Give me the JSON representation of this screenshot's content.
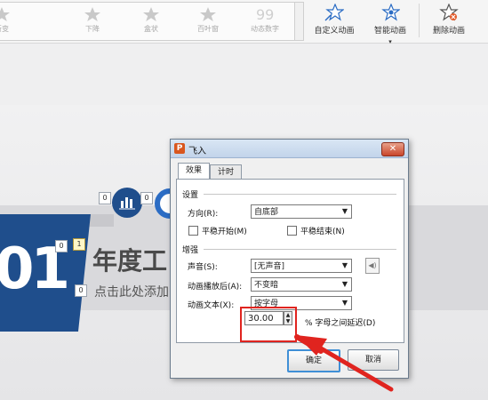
{
  "ribbon": {
    "gallery": [
      {
        "label": "渐变",
        "icon": "fade-star-icon"
      },
      {
        "label": "下降",
        "icon": "descend-star-icon"
      },
      {
        "label": "盒状",
        "icon": "box-star-icon"
      },
      {
        "label": "百叶窗",
        "icon": "blinds-star-icon"
      },
      {
        "label": "动态数字",
        "icon": "dynamic-number-icon"
      }
    ],
    "buttons": {
      "custom_animation": "自定义动画",
      "smart_animation": "智能动画",
      "smart_animation_arrow": "▾",
      "delete_animation": "删除动画"
    }
  },
  "slide": {
    "number": "01",
    "title": "年度工",
    "subtitle": "点击此处添加",
    "tags": [
      "0",
      "1",
      "0",
      "0",
      "0"
    ]
  },
  "dialog": {
    "title": "飞入",
    "close_glyph": "✕",
    "tabs": [
      "效果",
      "计时"
    ],
    "settings": {
      "group_label": "设置",
      "direction_label": "方向(R):",
      "direction_value": "自底部",
      "smooth_start_label": "平稳开始(M)",
      "smooth_end_label": "平稳结束(N)"
    },
    "enhance": {
      "group_label": "增强",
      "sound_label": "声音(S):",
      "sound_value": "[无声音]",
      "after_animation_label": "动画播放后(A):",
      "after_animation_value": "不变暗",
      "animate_text_label": "动画文本(X):",
      "animate_text_value": "按字母",
      "delay_value": "30.00",
      "delay_unit_label": "% 字母之间延迟(D)"
    },
    "ok_label": "确定",
    "cancel_label": "取消"
  },
  "colors": {
    "annotation_red": "#e0241f",
    "slide_blue": "#1f4e8c",
    "ring_blue": "#2b6cc4"
  }
}
